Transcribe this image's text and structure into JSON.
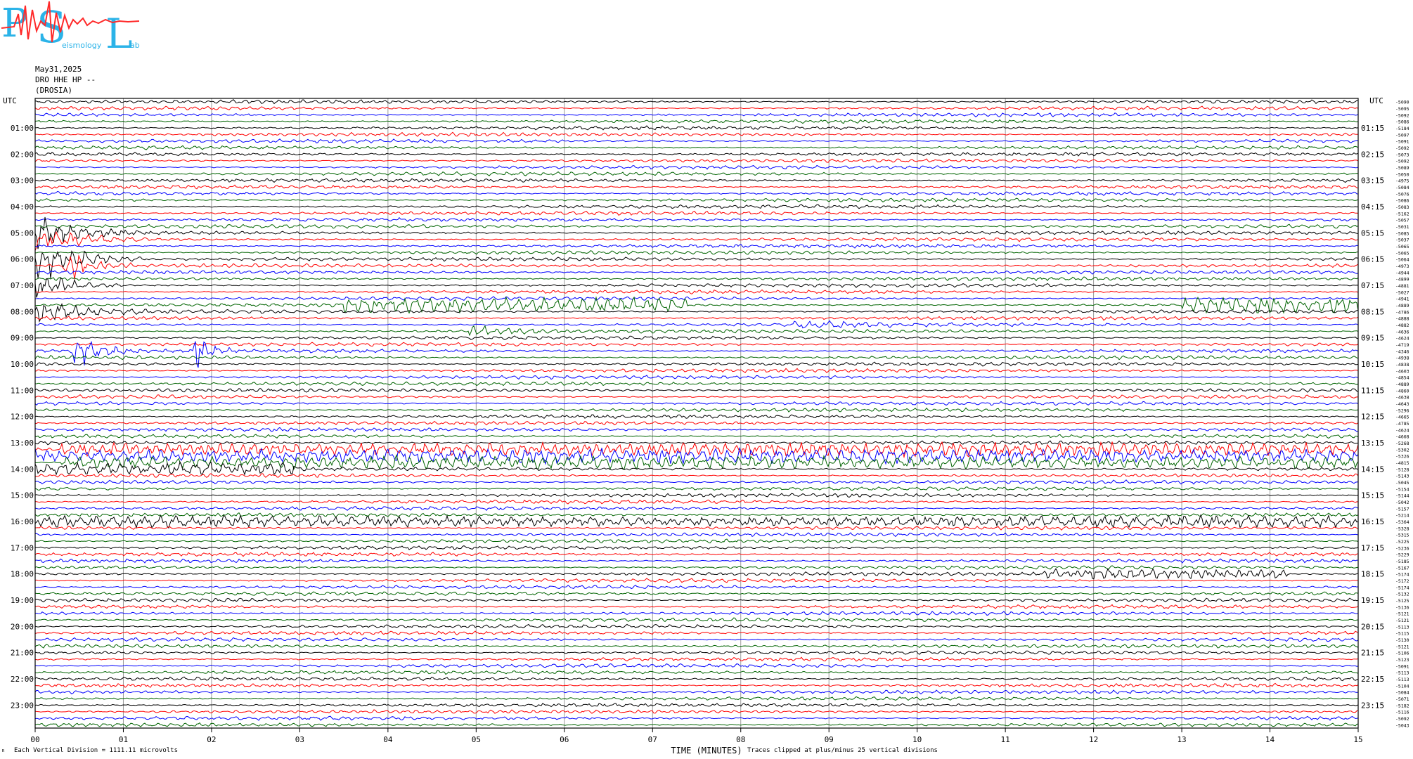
{
  "header": {
    "date": "May31,2025",
    "station": "DRO HHE HP --",
    "location": "(DROSIA)"
  },
  "logo": {
    "text_big": "PSL",
    "letters": [
      "P",
      "S",
      "L"
    ],
    "sub_words": [
      "eismology",
      "ab"
    ],
    "colors": {
      "blue": "#2bb3e8",
      "red": "#ff2a2a"
    }
  },
  "footer": {
    "left_mark": "ᴿ",
    "division_note": "Each Vertical Division = 1111.11 microvolts",
    "clip_note": "Traces clipped at plus/minus 25 vertical divisions"
  },
  "chart_data": {
    "type": "line",
    "xlabel": "TIME (MINUTES)",
    "x_ticks": [
      "00",
      "01",
      "02",
      "03",
      "04",
      "05",
      "06",
      "07",
      "08",
      "09",
      "10",
      "11",
      "12",
      "13",
      "14",
      "15"
    ],
    "xlim": [
      0,
      15
    ],
    "left_axis_title": "UTC",
    "right_axis_title": "UTC",
    "left_hour_labels": [
      "01:00",
      "02:00",
      "03:00",
      "04:00",
      "05:00",
      "06:00",
      "07:00",
      "08:00",
      "09:00",
      "10:00",
      "11:00",
      "12:00",
      "13:00",
      "14:00",
      "15:00",
      "16:00",
      "17:00",
      "18:00",
      "19:00",
      "20:00",
      "21:00",
      "22:00",
      "23:00"
    ],
    "right_hour_labels": [
      "01:15",
      "02:15",
      "03:15",
      "04:15",
      "05:15",
      "06:15",
      "07:15",
      "08:15",
      "09:15",
      "10:15",
      "11:15",
      "12:15",
      "13:15",
      "14:15",
      "15:15",
      "16:15",
      "17:15",
      "18:15",
      "19:15",
      "20:15",
      "21:15",
      "22:15",
      "23:15"
    ],
    "trace_count": 96,
    "traces_per_hour": 4,
    "trace_colors": [
      "#000000",
      "#ff0000",
      "#0000ff",
      "#006400"
    ],
    "trace_offsets": [
      "-5090",
      "-5095",
      "-5092",
      "-5086",
      "-5184",
      "-5097",
      "-5091",
      "-5092",
      "-5073",
      "-5092",
      "-5089",
      "-5050",
      "-4975",
      "-5084",
      "-5076",
      "-5086",
      "-5083",
      "-5162",
      "-5057",
      "-5031",
      "-5085",
      "-5037",
      "-5065",
      "-5065",
      "-5064",
      "-4973",
      "-4944",
      "-4899",
      "-4881",
      "-5027",
      "-4941",
      "-4889",
      "-4786",
      "-4888",
      "-4882",
      "-4636",
      "-4624",
      "-4719",
      "-4346",
      "-4938",
      "-4838",
      "-4603",
      "-4854",
      "-4889",
      "-4860",
      "-4638",
      "-4643",
      "-5296",
      "-4665",
      "-4785",
      "-4624",
      "-4668",
      "-5268",
      "-5302",
      "-5326",
      "-4815",
      "-5128",
      "-5143",
      "-5045",
      "-5154",
      "-5144",
      "-5042",
      "-5157",
      "-5214",
      "-5364",
      "-5328",
      "-5315",
      "-5225",
      "-5236",
      "-5229",
      "-5185",
      "-5167",
      "-5174",
      "-5172",
      "-5174",
      "-5132",
      "-5125",
      "-5136",
      "-5121",
      "-5121",
      "-5113",
      "-5115",
      "-5130",
      "-5121",
      "-5106",
      "-5123",
      "-5091",
      "-5113",
      "-5113",
      "-5104",
      "-5084",
      "-5071",
      "-5182",
      "-5116",
      "-5092",
      "-5043"
    ],
    "events": [
      {
        "trace": 20,
        "start": 0.0,
        "end": 1.2,
        "amp": 2.2
      },
      {
        "trace": 21,
        "start": 0.0,
        "end": 1.4,
        "amp": 1.6
      },
      {
        "trace": 24,
        "start": 0.0,
        "end": 1.2,
        "amp": 3.2
      },
      {
        "trace": 25,
        "start": 0.3,
        "end": 1.1,
        "amp": 2.4
      },
      {
        "trace": 28,
        "start": 0.0,
        "end": 1.0,
        "amp": 1.8
      },
      {
        "trace": 31,
        "start": 3.5,
        "end": 7.4,
        "amp": 0.7
      },
      {
        "trace": 31,
        "start": 13.0,
        "end": 15.0,
        "amp": 0.8
      },
      {
        "trace": 32,
        "start": 0.0,
        "end": 1.4,
        "amp": 1.6
      },
      {
        "trace": 34,
        "start": 8.6,
        "end": 10.4,
        "amp": 0.55
      },
      {
        "trace": 35,
        "start": 4.9,
        "end": 6.2,
        "amp": 0.8
      },
      {
        "trace": 38,
        "start": 0.4,
        "end": 1.2,
        "amp": 2.6
      },
      {
        "trace": 38,
        "start": 1.8,
        "end": 2.2,
        "amp": 3.4
      },
      {
        "trace": 53,
        "start": 0.3,
        "end": 15.0,
        "amp": 0.65
      },
      {
        "trace": 54,
        "start": 0.0,
        "end": 15.0,
        "amp": 0.7
      },
      {
        "trace": 55,
        "start": 0.3,
        "end": 15.0,
        "amp": 0.6
      },
      {
        "trace": 56,
        "start": 0.0,
        "end": 3.0,
        "amp": 0.6
      },
      {
        "trace": 64,
        "start": 0.0,
        "end": 15.0,
        "amp": 0.5
      },
      {
        "trace": 72,
        "start": 11.4,
        "end": 14.2,
        "amp": 0.45
      }
    ]
  }
}
